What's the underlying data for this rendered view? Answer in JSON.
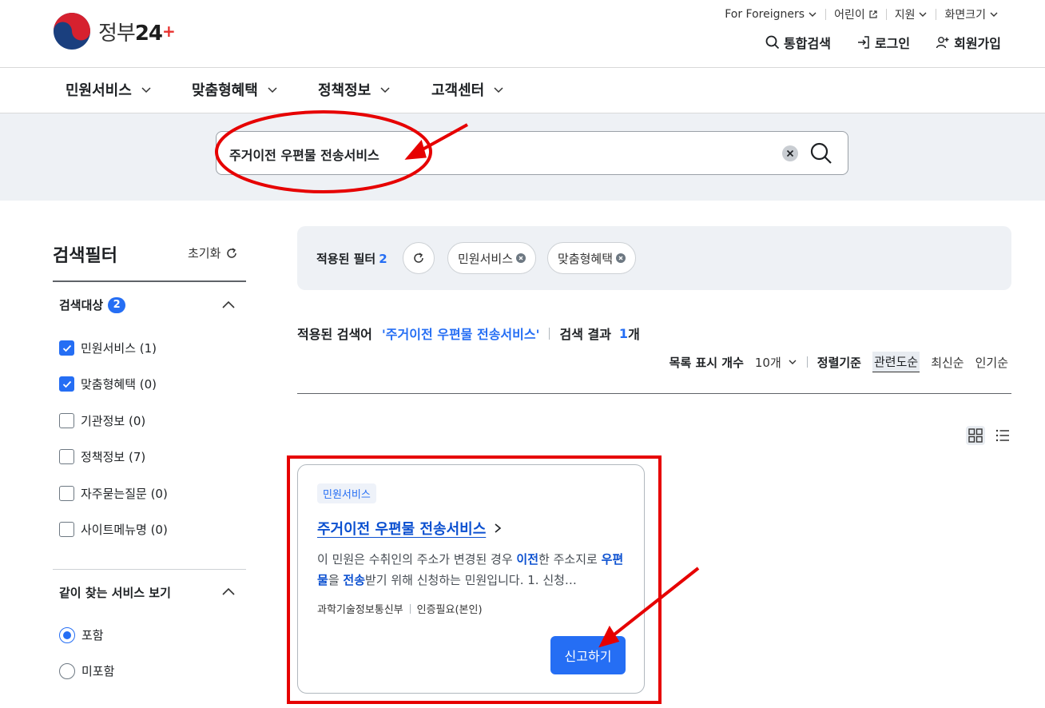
{
  "header": {
    "logo_text_a": "정부",
    "logo_text_b": "24",
    "util": [
      {
        "label": "For Foreigners",
        "icon": "chevron-down-icon"
      },
      {
        "label": "어린이",
        "icon": "external-link-icon"
      },
      {
        "label": "지원",
        "icon": "chevron-down-icon"
      },
      {
        "label": "화면크기",
        "icon": "chevron-down-icon"
      }
    ],
    "actions": {
      "search": "통합검색",
      "login": "로그인",
      "signup": "회원가입"
    }
  },
  "gnb": [
    "민원서비스",
    "맞춤형혜택",
    "정책정보",
    "고객센터"
  ],
  "search": {
    "value": "주거이전 우편물 전송서비스"
  },
  "filter": {
    "title": "검색필터",
    "reset": "초기화",
    "target": {
      "heading": "검색대상",
      "count": "2",
      "items": [
        {
          "label": "민원서비스 (1)",
          "checked": true
        },
        {
          "label": "맞춤형혜택 (0)",
          "checked": true
        },
        {
          "label": "기관정보 (0)",
          "checked": false
        },
        {
          "label": "정책정보 (7)",
          "checked": false
        },
        {
          "label": "자주묻는질문 (0)",
          "checked": false
        },
        {
          "label": "사이트메뉴명 (0)",
          "checked": false
        }
      ]
    },
    "related": {
      "heading": "같이 찾는 서비스 보기",
      "options": [
        {
          "label": "포함",
          "selected": true
        },
        {
          "label": "미포함",
          "selected": false
        }
      ]
    }
  },
  "applied": {
    "label": "적용된 필터",
    "count": "2",
    "chips": [
      "민원서비스",
      "맞춤형혜택"
    ]
  },
  "summary": {
    "label": "적용된 검색어",
    "query": "'주거이전 우편물 전송서비스'",
    "result_label": "검색 결과",
    "result_count": "1",
    "result_unit": "개"
  },
  "sort": {
    "page_size_label": "목록 표시 개수",
    "page_size": "10개",
    "sort_label": "정렬기준",
    "options": [
      "관련도순",
      "최신순",
      "인기순"
    ],
    "selected": "관련도순"
  },
  "card": {
    "tag": "민원서비스",
    "title": "주거이전 우편물 전송서비스",
    "desc": {
      "p1": "이 민원은 수취인의 주소가 변경된 경우 ",
      "k1": "이전",
      "p2": "한 주소지로 ",
      "k2": "우편물",
      "p3": "을 ",
      "k3": "전송",
      "p4": "받기 위해 신청하는 민원입니다. 1. 신청…"
    },
    "agency": "과학기술정보통신부",
    "auth": "인증필요(본인)",
    "button": "신고하기"
  },
  "colors": {
    "accent": "#256ef4",
    "link": "#0b50d0",
    "annotation": "#e60000",
    "band": "#eef1f5"
  }
}
